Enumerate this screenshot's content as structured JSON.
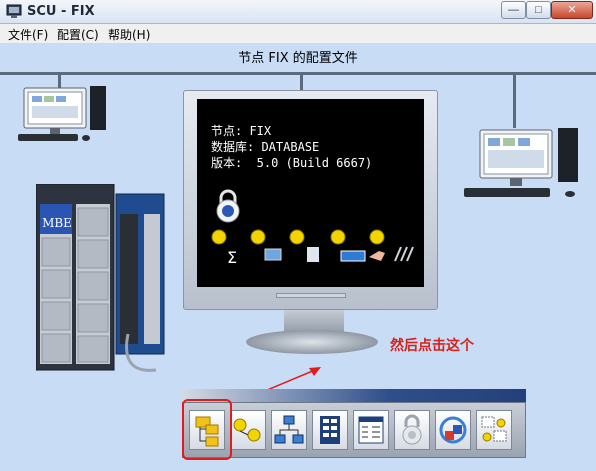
{
  "window": {
    "title": "SCU - FIX",
    "minimize_glyph": "—",
    "maximize_glyph": "□",
    "close_glyph": "✕"
  },
  "menu": {
    "items": [
      {
        "label": "文件(F)"
      },
      {
        "label": "配置(C)"
      },
      {
        "label": "帮助(H)"
      }
    ]
  },
  "canvas": {
    "title": "节点 FIX 的配置文件",
    "instruction": "然后点击这个"
  },
  "screen": {
    "node_line": "节点: FIX",
    "database_line": "数据库: DATABASE",
    "version_line": "版本:  5.0 (Build 6667)"
  },
  "plc": {
    "module_label": "MBE"
  },
  "toolbar": {
    "buttons": [
      {
        "icon": "folder-tree-icon"
      },
      {
        "icon": "network-nodes-icon"
      },
      {
        "icon": "network-computers-icon"
      },
      {
        "icon": "database-icon"
      },
      {
        "icon": "alarm-list-icon"
      },
      {
        "icon": "security-lock-icon"
      },
      {
        "icon": "sql-tasks-icon"
      },
      {
        "icon": "scada-config-icon"
      }
    ]
  },
  "colors": {
    "canvas_bg": "#c8dcf5",
    "hint_red": "#d2231c",
    "highlight_red": "#e21b1b",
    "screen_bg": "#000000",
    "screen_icon_yellow": "#f3d300"
  }
}
